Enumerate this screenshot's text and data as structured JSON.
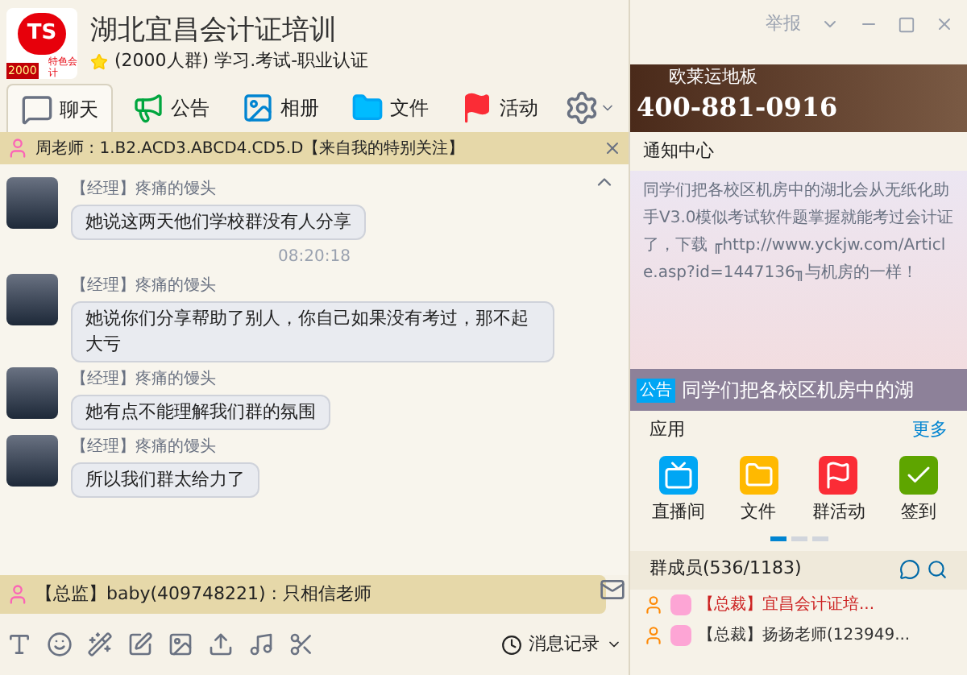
{
  "group": {
    "logo_text": "TS",
    "logo_badge": "2000",
    "logo_tag": "特色会计",
    "name": "湖北宜昌会计证培训",
    "subtitle": "(2000人群) 学习.考试-职业认证"
  },
  "tabs": [
    {
      "label": "聊天",
      "selected": true
    },
    {
      "label": "公告",
      "selected": false
    },
    {
      "label": "相册",
      "selected": false
    },
    {
      "label": "文件",
      "selected": false
    },
    {
      "label": "活动",
      "selected": false
    }
  ],
  "top_notice": {
    "text": "周老师 : 1.B2.ACD3.ABCD4.CD5.D【来自我的特别关注】"
  },
  "messages": [
    {
      "kind": "message",
      "sender": "【经理】疼痛的馒头",
      "text": "她说这两天他们学校群没有人分享"
    },
    {
      "kind": "time",
      "text": "08:20:18"
    },
    {
      "kind": "message",
      "sender": "【经理】疼痛的馒头",
      "text": "她说你们分享帮助了别人，你自己如果没有考过，那不起大亏"
    },
    {
      "kind": "message",
      "sender": "【经理】疼痛的馒头",
      "text": "她有点不能理解我们群的氛围"
    },
    {
      "kind": "message",
      "sender": "【经理】疼痛的馒头",
      "text": "所以我们群太给力了"
    }
  ],
  "bottom_notice": {
    "text": "【总监】baby(409748221) : 只相信老师"
  },
  "history_button": "消息记录",
  "window_controls": {
    "report": "举报"
  },
  "ad": {
    "title": "欧莱运地板",
    "phone": "400-881-0916"
  },
  "notice_center": {
    "title": "通知中心",
    "text": "同学们把各校区机房中的湖北会从无纸化助手V3.0模似考试软件题掌握就能考过会计证了，下载 ╓http://www.yckjw.com/Article.asp?id=1447136╖与机房的一样！"
  },
  "announcement": {
    "badge": "公告",
    "text": "同学们把各校区机房中的湖"
  },
  "apps": {
    "title": "应用",
    "more": "更多",
    "items": [
      {
        "label": "直播间"
      },
      {
        "label": "文件"
      },
      {
        "label": "群活动"
      },
      {
        "label": "签到"
      }
    ]
  },
  "members": {
    "title": "群成员(536/1183)",
    "items": [
      {
        "text": "【总裁】宜昌会计证培...",
        "color": "#cc2222"
      },
      {
        "text": "【总裁】扬扬老师(123949...",
        "color": "#333333"
      }
    ]
  }
}
